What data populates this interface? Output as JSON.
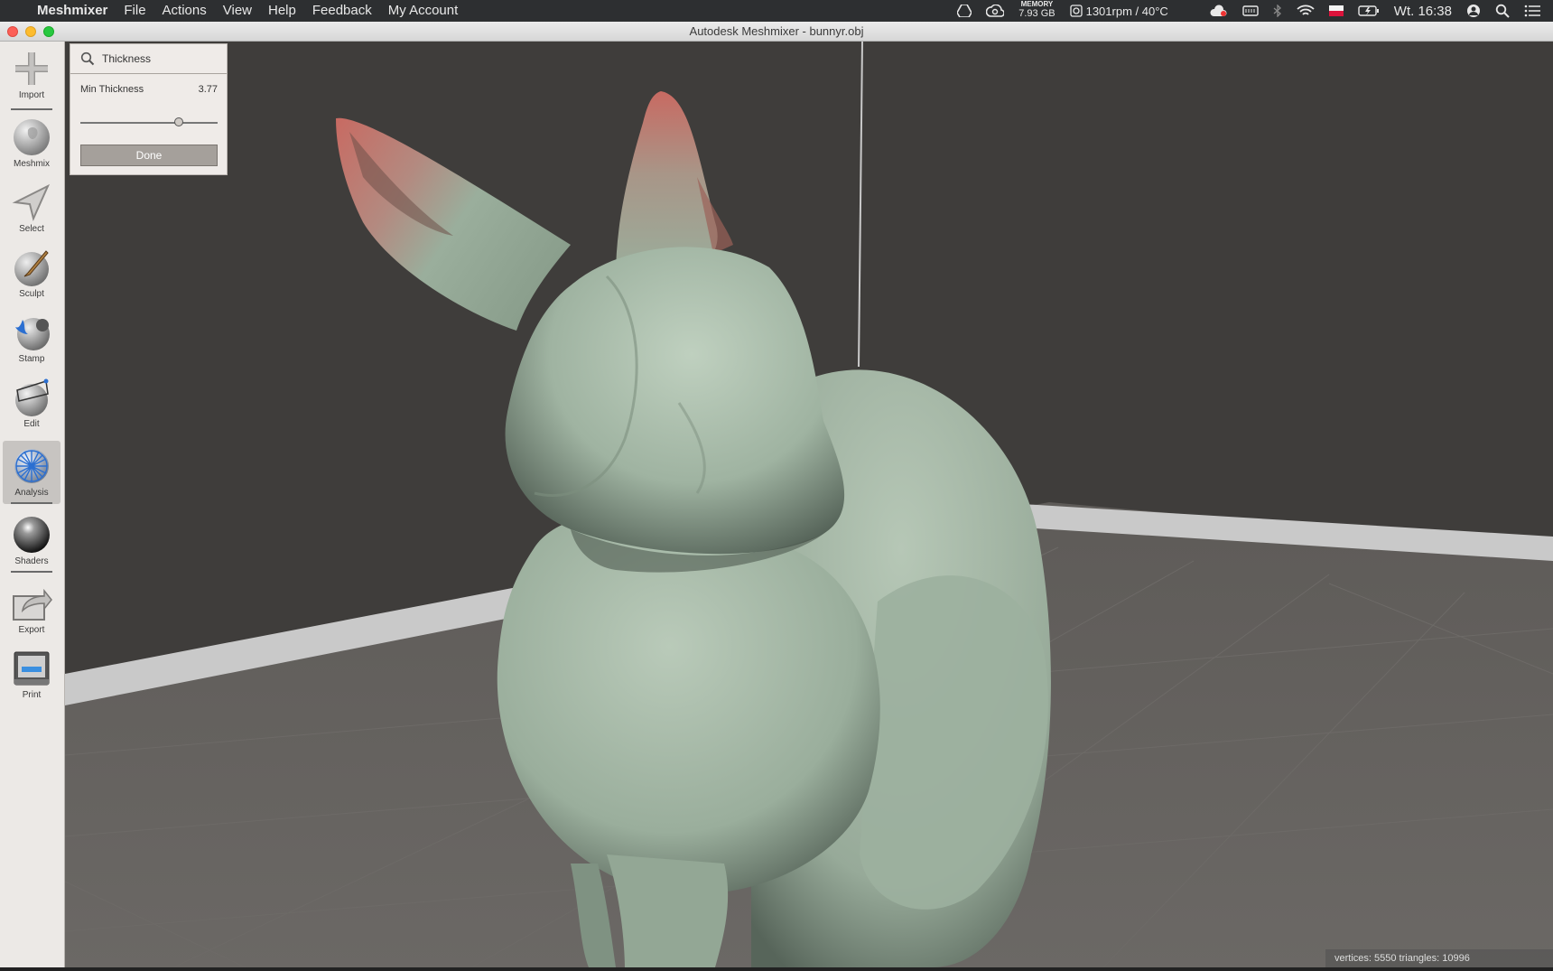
{
  "menubar": {
    "apple_glyph": "",
    "app_name": "Meshmixer",
    "items": [
      "File",
      "Actions",
      "View",
      "Help",
      "Feedback",
      "My Account"
    ],
    "memory_label": "MEMORY",
    "memory_value": "7.93 GB",
    "fan_status": "1301rpm / 40°C",
    "clock": "Wt. 16:38",
    "status_icons": [
      "google-drive-icon",
      "creative-cloud-icon",
      "memory-icon",
      "fan-icon",
      "cloud-icon",
      "keyboard-icon",
      "bluetooth-icon",
      "wifi-icon",
      "flag-icon",
      "battery-icon",
      "user-icon",
      "spotlight-icon",
      "notification-list-icon"
    ]
  },
  "window": {
    "title": "Autodesk Meshmixer - bunnyr.obj",
    "buttons": {
      "close": "#fc5f57",
      "minimize": "#fdbc2e",
      "maximize": "#28c840"
    }
  },
  "sidebar": {
    "tools": [
      {
        "id": "import",
        "label": "Import",
        "icon": "plus-icon",
        "active": false
      },
      {
        "id": "meshmix",
        "label": "Meshmix",
        "icon": "meshmix-bunny-icon",
        "active": false
      },
      {
        "id": "select",
        "label": "Select",
        "icon": "arrow-pointer-icon",
        "active": false
      },
      {
        "id": "sculpt",
        "label": "Sculpt",
        "icon": "brush-sphere-icon",
        "active": false
      },
      {
        "id": "stamp",
        "label": "Stamp",
        "icon": "stamp-sphere-icon",
        "active": false
      },
      {
        "id": "edit",
        "label": "Edit",
        "icon": "edit-sphere-icon",
        "active": false
      },
      {
        "id": "analysis",
        "label": "Analysis",
        "icon": "analysis-mesh-sphere-icon",
        "active": true
      },
      {
        "id": "shaders",
        "label": "Shaders",
        "icon": "shaders-sphere-icon",
        "active": false
      },
      {
        "id": "export",
        "label": "Export",
        "icon": "export-icon",
        "active": false
      },
      {
        "id": "print",
        "label": "Print",
        "icon": "printer-icon",
        "active": false
      }
    ]
  },
  "panel": {
    "title": "Thickness",
    "param_label": "Min Thickness",
    "param_value": "3.77",
    "slider_fraction": 0.73,
    "done_label": "Done"
  },
  "viewport": {
    "status": "vertices: 5550 triangles: 10996",
    "colors": {
      "wall": "#3f3d3b",
      "floor": "#605d5a",
      "mesh": "#a8bba9",
      "thin": "#c26a62"
    }
  }
}
